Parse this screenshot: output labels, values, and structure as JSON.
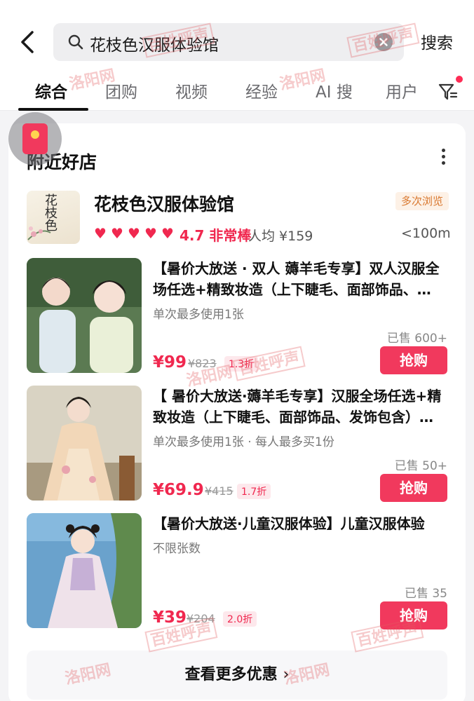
{
  "header": {
    "search_query": "花枝色汉服体验馆",
    "search_button": "搜索"
  },
  "tabs": [
    {
      "label": "综合",
      "active": true
    },
    {
      "label": "团购"
    },
    {
      "label": "视频"
    },
    {
      "label": "经验"
    },
    {
      "label": "AI 搜"
    },
    {
      "label": "用户"
    }
  ],
  "section": {
    "title": "附近好店"
  },
  "shop": {
    "logo_text": "花枝色",
    "name": "花枝色汉服体验馆",
    "badge": "多次浏览",
    "rating_hearts": 5,
    "rating": "4.7 非常棒",
    "avg_price": "人均 ¥159",
    "distance": "<100m"
  },
  "deals": [
    {
      "title": "【暑价大放送 · 双人 薅羊毛专享】双人汉服全场任选+精致妆造（上下睫毛、面部饰品、…",
      "limit": "单次最多使用1张",
      "sold": "已售 600+",
      "price": "¥99",
      "original_price": "¥823",
      "discount": "1.3折",
      "buy_label": "抢购"
    },
    {
      "title": "【 暑价大放送·薅羊毛专享】汉服全场任选+精致妆造（上下睫毛、面部饰品、发饰包含）…",
      "limit": "单次最多使用1张 · 每人最多买1份",
      "sold": "已售 50+",
      "price": "¥69.9",
      "original_price": "¥415",
      "discount": "1.7折",
      "buy_label": "抢购"
    },
    {
      "title": "【暑价大放送·儿童汉服体验】儿童汉服体验",
      "limit": "不限张数",
      "sold": "已售 35",
      "price": "¥39",
      "original_price": "¥204",
      "discount": "2.0折",
      "buy_label": "抢购"
    }
  ],
  "more_deals": "查看更多优惠",
  "watermark": {
    "site": "洛阳网",
    "column": "百姓呼声"
  },
  "colors": {
    "accent": "#f1395d",
    "price": "#f0284f",
    "badge_text": "#d9782f"
  }
}
